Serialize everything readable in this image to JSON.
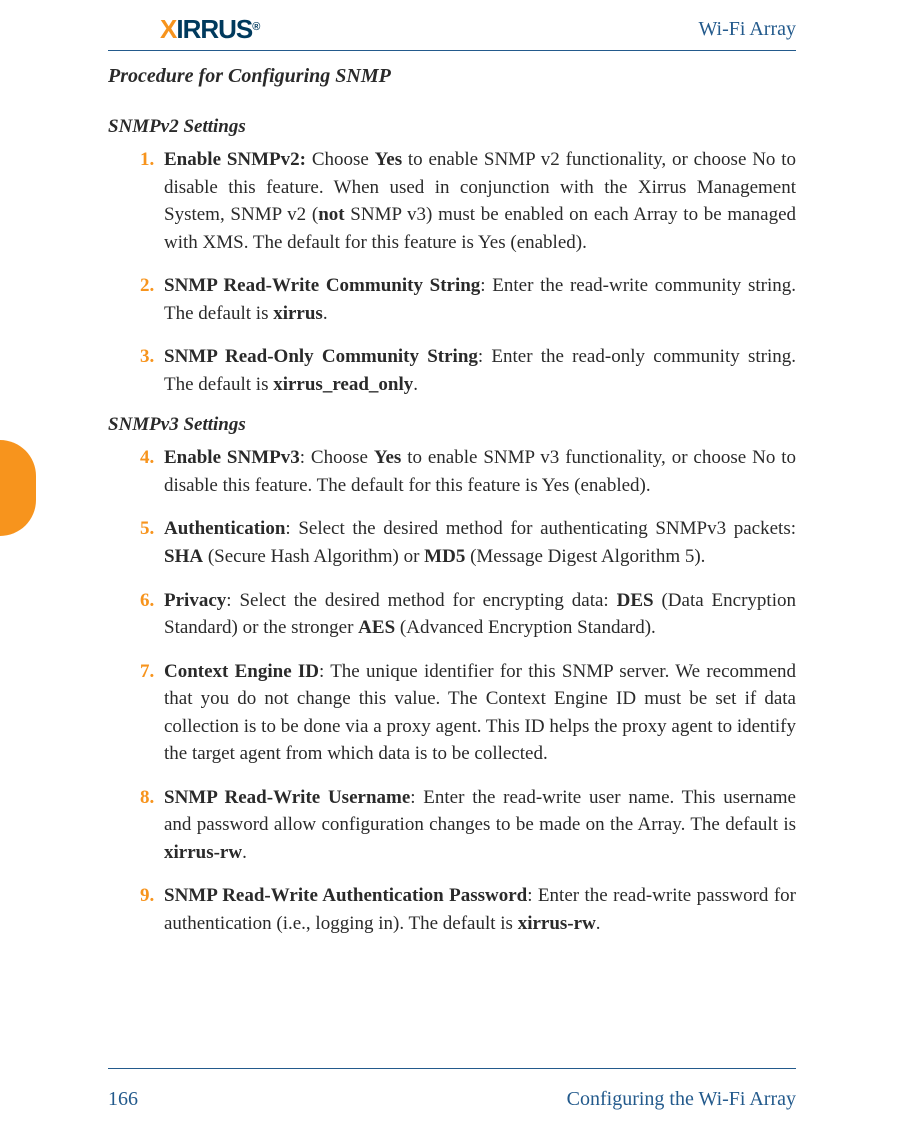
{
  "header": {
    "logo_x": "X",
    "logo_rest": "IRRUS",
    "logo_reg": "®",
    "right": "Wi-Fi Array"
  },
  "title": "Procedure for Configuring SNMP",
  "sections": {
    "v2": {
      "heading": "SNMPv2 Settings",
      "items": [
        {
          "num": "1.",
          "lead": "Enable SNMPv2:",
          "t1": " Choose ",
          "b1": "Yes",
          "t2": " to enable SNMP v2 functionality, or choose No to disable this feature. When used in conjunction with the Xirrus Management System, SNMP v2 (",
          "b2": "not",
          "t3": " SNMP v3) must be enabled on each Array to be managed with XMS. The default for this feature is Yes (enabled)."
        },
        {
          "num": "2.",
          "lead": "SNMP Read-Write Community String",
          "t1": ": Enter the read-write community string. The default is ",
          "b1": "xirrus",
          "t2": "."
        },
        {
          "num": "3.",
          "lead": "SNMP Read-Only Community String",
          "t1": ": Enter the read-only community string. The default is ",
          "b1": "xirrus_read_only",
          "t2": "."
        }
      ]
    },
    "v3": {
      "heading": "SNMPv3 Settings",
      "items": [
        {
          "num": "4.",
          "lead": "Enable SNMPv3",
          "t1": ": Choose ",
          "b1": "Yes",
          "t2": " to enable SNMP v3 functionality, or choose No to disable this feature. The default for this feature is Yes (enabled)."
        },
        {
          "num": "5.",
          "lead": "Authentication",
          "t1": ": Select the desired method for authenticating SNMPv3 packets: ",
          "b1": "SHA",
          "t2": " (Secure Hash Algorithm) or ",
          "b2": "MD5",
          "t3": " (Message Digest Algorithm 5)."
        },
        {
          "num": "6.",
          "lead": "Privacy",
          "t1": ": Select the desired method for encrypting data: ",
          "b1": "DES",
          "t2": " (Data Encryption Standard) or the stronger ",
          "b2": "AES",
          "t3": " (Advanced Encryption Standard)."
        },
        {
          "num": "7.",
          "lead": "Context Engine ID",
          "t1": ": The unique identifier for this SNMP server. We recommend that you do not change this value. The Context Engine ID must be set if data collection is to be done via a proxy agent. This ID helps the proxy agent to identify the target agent from which data is to be collected."
        },
        {
          "num": "8.",
          "lead": "SNMP Read-Write Username",
          "t1": ": Enter the read-write user name. This username and password allow configuration changes to be made on the Array. The default is ",
          "b1": "xirrus-rw",
          "t2": "."
        },
        {
          "num": "9.",
          "lead": "SNMP Read-Write Authentication Password",
          "t1": ": Enter the read-write password for authentication (i.e., logging in). The default is ",
          "b1": "xirrus-rw",
          "t2": "."
        }
      ]
    }
  },
  "footer": {
    "page": "166",
    "title": "Configuring the Wi-Fi Array"
  }
}
